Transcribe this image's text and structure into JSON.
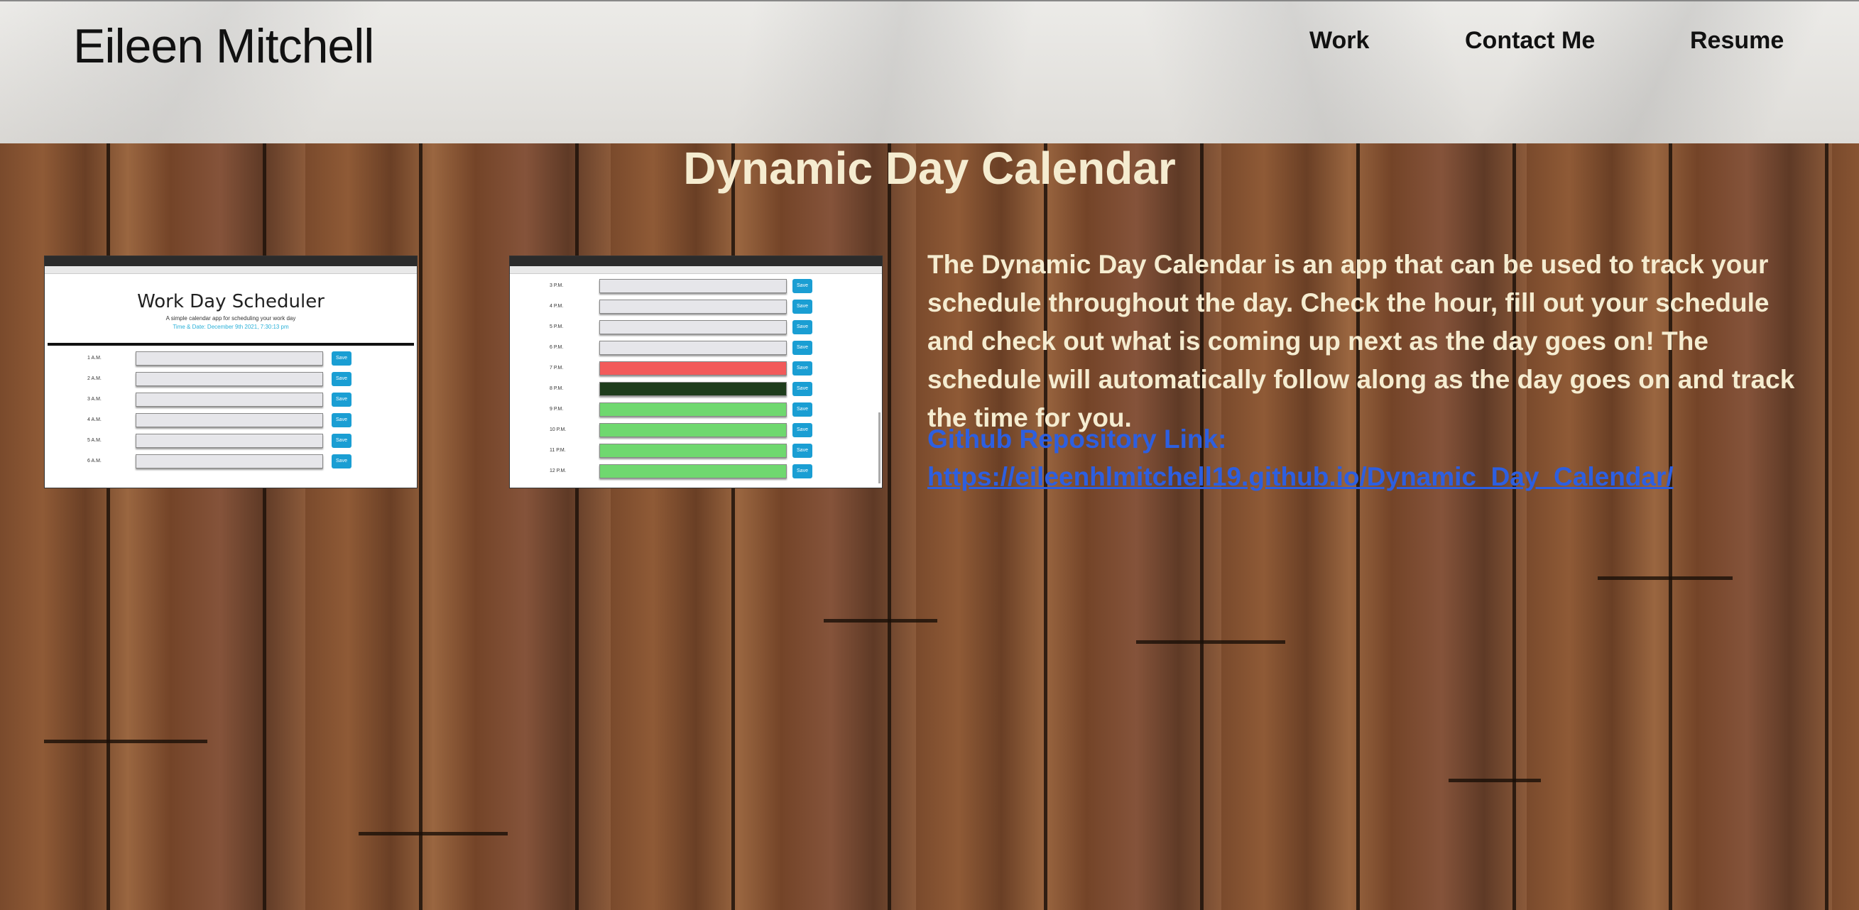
{
  "header": {
    "brand": "Eileen Mitchell",
    "nav": [
      "Work",
      "Contact Me",
      "Resume"
    ]
  },
  "project": {
    "title": "Dynamic Day Calendar",
    "description": "The Dynamic Day Calendar is an app that can be used to track your schedule throughout the day. Check the hour, fill out your schedule and check out what is coming up next as the day goes on! The schedule will automatically follow along as the day goes on and track the time for you.",
    "link_label": "Github Repository Link:",
    "link_url": "https://eileenhlmitchell19.github.io/Dynamic_Day_Calendar/"
  },
  "screenshot1": {
    "title": "Work Day Scheduler",
    "subtitle": "A simple calendar app for scheduling your work day",
    "date": "Time & Date: December 9th 2021, 7:30:13 pm",
    "save_label": "Save",
    "rows": [
      "1 A.M.",
      "2 A.M.",
      "3 A.M.",
      "4 A.M.",
      "5 A.M.",
      "6 A.M."
    ]
  },
  "screenshot2": {
    "save_label": "Save",
    "rows": [
      {
        "hour": "3 P.M.",
        "state": "past"
      },
      {
        "hour": "4 P.M.",
        "state": "past"
      },
      {
        "hour": "5 P.M.",
        "state": "past"
      },
      {
        "hour": "6 P.M.",
        "state": "past"
      },
      {
        "hour": "7 P.M.",
        "state": "present"
      },
      {
        "hour": "8 P.M.",
        "state": "present-dark"
      },
      {
        "hour": "9 P.M.",
        "state": "future"
      },
      {
        "hour": "10 P.M.",
        "state": "future"
      },
      {
        "hour": "11 P.M.",
        "state": "future"
      },
      {
        "hour": "12 P.M.",
        "state": "future"
      }
    ],
    "colors": {
      "past": "#e6e6ea",
      "present": "#f25a5a",
      "present-dark": "#1e3d1c",
      "future": "#6fd86f"
    }
  }
}
